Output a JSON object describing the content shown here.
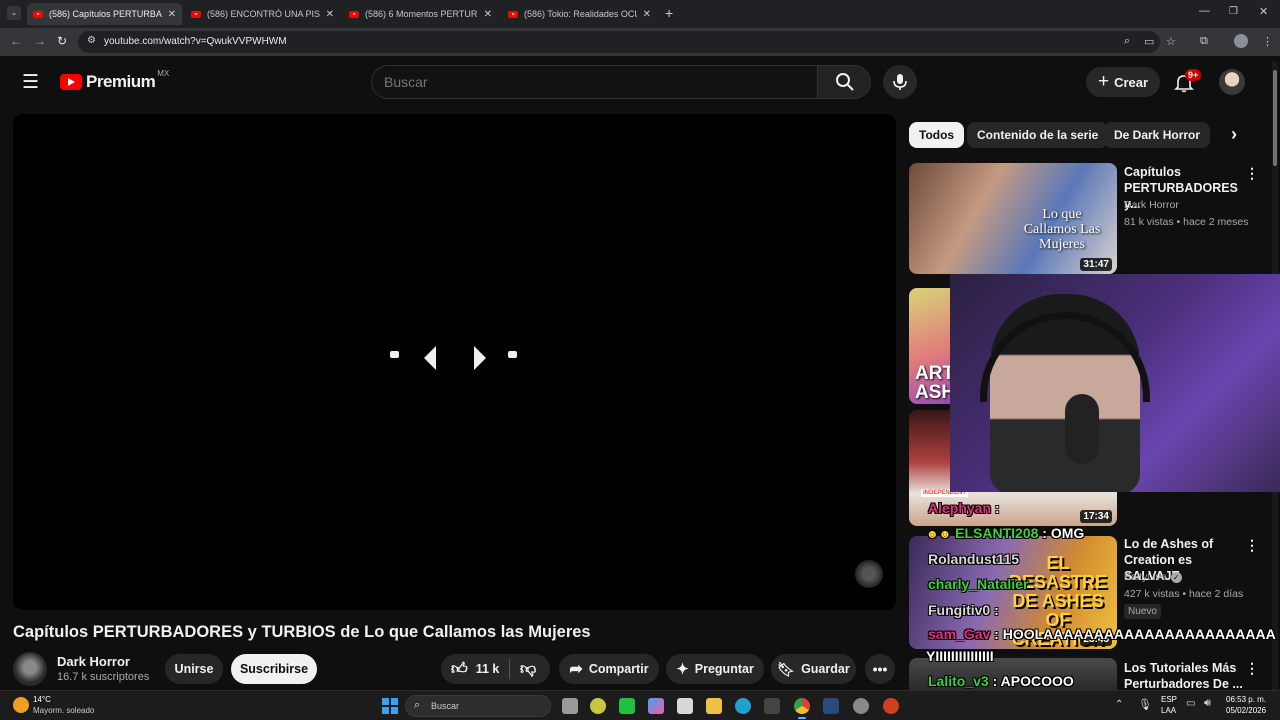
{
  "browser": {
    "tabs": [
      {
        "title": "(586) Capítulos PERTURBADORES",
        "active": true
      },
      {
        "title": "(586) ENCONTRÓ UNA PISCINA",
        "active": false
      },
      {
        "title": "(586) 6 Momentos PERTURBAD",
        "active": false
      },
      {
        "title": "(586) Tokio: Realidades OCULTA",
        "active": false
      }
    ],
    "url": "youtube.com/watch?v=QwukVVPWHWM"
  },
  "header": {
    "logo_text": "Premium",
    "region": "MX",
    "search_placeholder": "Buscar",
    "create_label": "Crear",
    "notif_count": "9+"
  },
  "video": {
    "title": "Capítulos PERTURBADORES y TURBIOS de Lo que Callamos las Mujeres",
    "channel": "Dark Horror",
    "subscribers": "16.7 k suscriptores",
    "join_label": "Unirse",
    "subscribe_label": "Suscribirse",
    "likes": "11 k",
    "share_label": "Compartir",
    "ask_label": "Preguntar",
    "save_label": "Guardar"
  },
  "sidebar": {
    "chips": [
      "Todos",
      "Contenido de la serie",
      "De Dark Horror"
    ],
    "items": [
      {
        "title": "Capítulos PERTURBADORES y...",
        "channel": "Dark Horror",
        "meta": "81 k vistas • hace 2 meses",
        "duration": "31:47",
        "thumb_text": "Lo que Callamos Las Mujeres"
      },
      {
        "title": "",
        "channel": "",
        "meta": "",
        "duration": "",
        "thumb_text": "ART ASH"
      },
      {
        "title": "",
        "channel": "",
        "meta": "",
        "duration": "17:34",
        "thumb_text": "INDEPENDENT"
      },
      {
        "title": "Lo de Ashes of Creation es SALVAJE",
        "channel": "BaityLive",
        "meta": "427 k vistas • hace 2 días",
        "badge": "Nuevo",
        "duration": "23:45",
        "thumb_text": "EL DESASTRE DE ASHES OF CREATION"
      },
      {
        "title": "Los Tutoriales Más Perturbadores De ...",
        "channel": "",
        "meta": "",
        "duration": ""
      }
    ]
  },
  "chat": [
    {
      "user": "Alephyan",
      "msg": ":",
      "color": "#e0347e"
    },
    {
      "user": "ELSANTI208",
      "msg": ": OMG",
      "color": "#3ad13a"
    },
    {
      "user": "Rolandust115",
      "msg": "",
      "color": "#d8d8d8"
    },
    {
      "user": "charly_Natalier",
      "msg": "",
      "color": "#3ad13a"
    },
    {
      "user": "Fungitiv0",
      "msg": ":",
      "color": "#d8d8d8"
    },
    {
      "user": "sam_Gav",
      "msg": ": HOOLAAAAAAAAAAAAAAAAAAAAAAA",
      "color": "#e0347e"
    },
    {
      "user": "",
      "msg": "YIIIIIIIIIIIIIII",
      "color": "#ffffff"
    },
    {
      "user": "Lalito_v3",
      "msg": ": APOCOOO",
      "color": "#3ad13a"
    }
  ],
  "taskbar": {
    "temp": "14°C",
    "weather": "Mayorm. soleado",
    "search_label": "Buscar",
    "lang": "ESP",
    "lang2": "LAA",
    "time": "06:53 p. m.",
    "date": "05/02/2026"
  }
}
